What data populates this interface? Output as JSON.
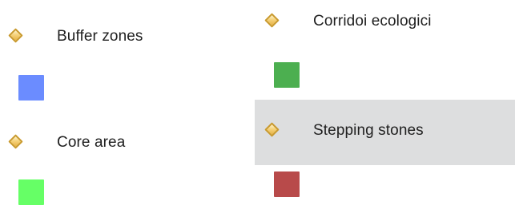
{
  "legend": {
    "left_column": [
      {
        "label": "Buffer zones",
        "icon": "diamond-icon",
        "swatch_color": "#6b8cff"
      },
      {
        "label": "Core area",
        "icon": "diamond-icon",
        "swatch_color": "#66ff66"
      }
    ],
    "right_column": [
      {
        "label": "Corridoi ecologici",
        "icon": "diamond-icon",
        "swatch_color": "#4caf50"
      },
      {
        "label": "Stepping stones",
        "icon": "diamond-icon",
        "swatch_color": "#b84a4a",
        "highlighted": true
      }
    ]
  },
  "colors": {
    "highlight_background": "#dddedf",
    "diamond_fill": "#f5d27a",
    "diamond_border": "#c99a2e"
  }
}
